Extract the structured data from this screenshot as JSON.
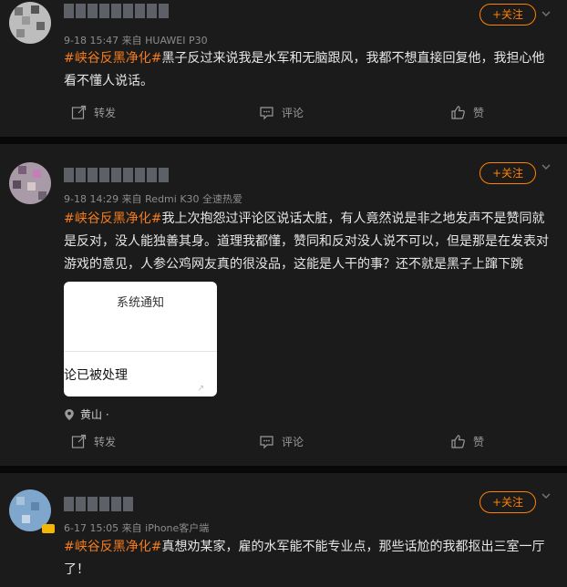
{
  "posts": [
    {
      "meta": "9-18 15:47 来自 HUAWEI P30",
      "follow": "+关注",
      "hashtag": "#峡谷反黑净化#",
      "body": "黑子反过来说我是水军和无脑跟风，我都不想直接回复他，我担心他看不懂人说话。",
      "actions": {
        "repost": "转发",
        "comment": "评论",
        "like": "赞"
      }
    },
    {
      "meta": "9-18 14:29 来自 Redmi K30 全速热爱",
      "follow": "+关注",
      "hashtag": "#峡谷反黑净化#",
      "body": "我上次抱怨过评论区说话太脏，有人竟然说是非之地发声不是赞同就是反对，没人能独善其身。道理我都懂，赞同和反对没人说不可以，但是那是在发表对游戏的意见，人参公鸡网友真的很没品，这能是人干的事？还不就是黑子上蹿下跳",
      "card": {
        "title": "系统通知",
        "body": "论已被处理"
      },
      "location": "黄山 ·",
      "actions": {
        "repost": "转发",
        "comment": "评论",
        "like": "赞"
      }
    },
    {
      "meta": "6-17 15:05 来自 iPhone客户端",
      "follow": "+关注",
      "hashtag": "#峡谷反黑净化#",
      "body": "真想劝某家，雇的水军能不能专业点，那些话尬的我都抠出三室一厅了！"
    }
  ],
  "colors": {
    "accent": "#ff8200",
    "hashtag": "#f57c20",
    "bg": "#1b1b1b"
  },
  "icons": {
    "repost": "repost-icon",
    "comment": "comment-icon",
    "like": "like-icon",
    "location": "location-pin-icon",
    "menu": "chevron-down-icon"
  }
}
